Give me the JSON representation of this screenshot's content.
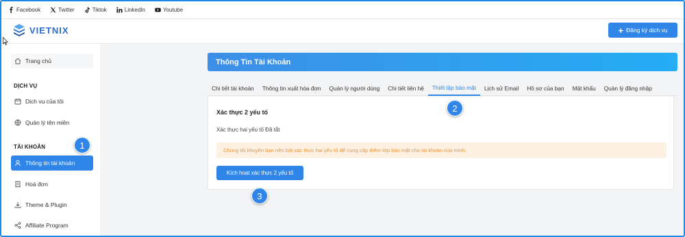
{
  "social": [
    {
      "label": "Facebook",
      "icon": "facebook-icon"
    },
    {
      "label": "Twitter",
      "icon": "x-twitter-icon"
    },
    {
      "label": "Tiktok",
      "icon": "tiktok-icon"
    },
    {
      "label": "LinkedIn",
      "icon": "linkedin-icon"
    },
    {
      "label": "Youtube",
      "icon": "youtube-icon"
    }
  ],
  "header": {
    "brand": "VIETNIX",
    "register_label": "Đăng ký dịch vụ"
  },
  "sidebar": {
    "home": "Trang chủ",
    "section_service": "DỊCH VỤ",
    "my_services": "Dịch vụ của tôi",
    "domains": "Quản lý tên miền",
    "section_account": "TÀI KHOẢN",
    "account_info": "Thông tin tài khoản",
    "invoices": "Hoá đơn",
    "theme_plugin": "Theme & Plugin",
    "affiliate": "Affiliate Program"
  },
  "main": {
    "title": "Thông Tin Tài Khoản",
    "tabs": [
      "Chi tiết tài khoản",
      "Thông tin xuất hóa đơn",
      "Quản lý người dùng",
      "Chi tiết liên hệ",
      "Thiết lập bảo mật",
      "Lịch sử Email",
      "Hồ sơ của bạn",
      "Mật khẩu",
      "Quản lý đăng nhập"
    ],
    "active_tab": 4,
    "card_title": "Xác thực 2 yếu tố",
    "status": "Xác thực hai yếu tố Đã tắt",
    "alert": "Chúng tôi khuyên bạn nên bật xác thực hai yếu tố để cung cấp thêm lớp bảo mật cho tài khoản của mình.",
    "activate_label": "Kích hoạt xác thực 2 yếu tố"
  },
  "markers": [
    "1",
    "2",
    "3"
  ],
  "colors": {
    "accent": "#2f86e8",
    "alert_bg": "#fdf1e3",
    "alert_text": "#e8943a",
    "frame": "#1e88e5"
  }
}
